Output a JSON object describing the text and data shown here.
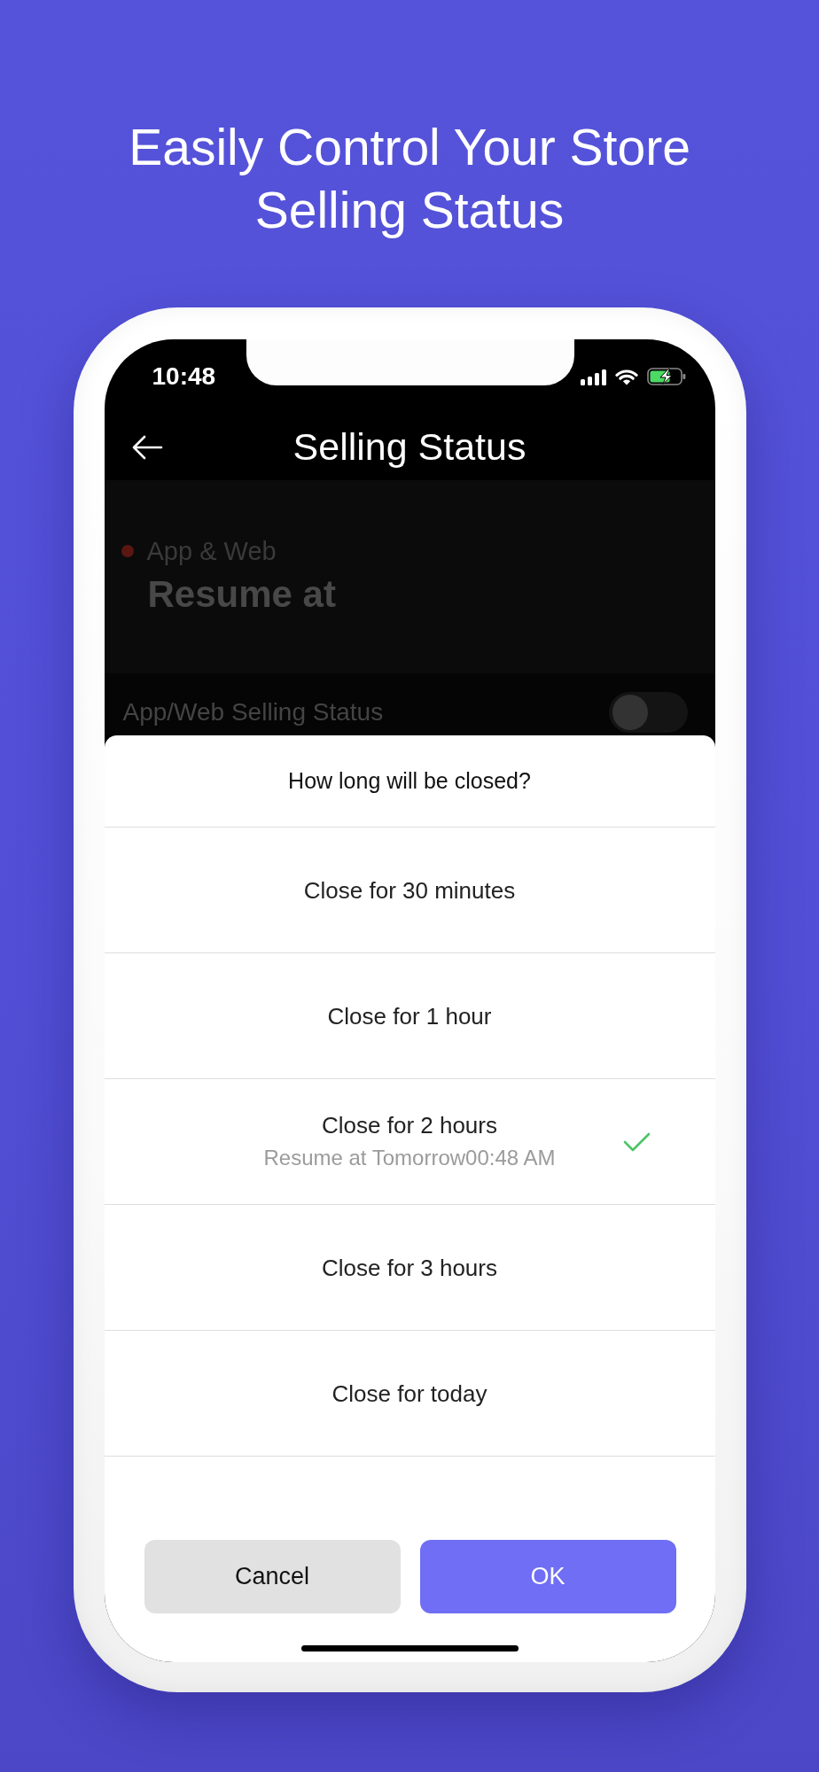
{
  "headline": "Easily Control Your Store Selling Status",
  "status_bar": {
    "time": "10:48"
  },
  "header": {
    "title": "Selling Status"
  },
  "background": {
    "channel": "App & Web",
    "resume_label": "Resume at",
    "selling_status": {
      "label": "App/Web Selling Status",
      "on": false
    }
  },
  "sheet": {
    "title": "How long will be closed?",
    "options": [
      {
        "label": "Close for 30 minutes",
        "selected": false
      },
      {
        "label": "Close for 1 hour",
        "selected": false
      },
      {
        "label": "Close for 2 hours",
        "detail": "Resume at Tomorrow00:48 AM",
        "selected": true
      },
      {
        "label": "Close for 3 hours",
        "selected": false
      },
      {
        "label": "Close for today",
        "selected": false
      }
    ],
    "buttons": [
      {
        "label": "Cancel",
        "kind": "secondary"
      },
      {
        "label": "OK",
        "kind": "primary"
      }
    ]
  }
}
